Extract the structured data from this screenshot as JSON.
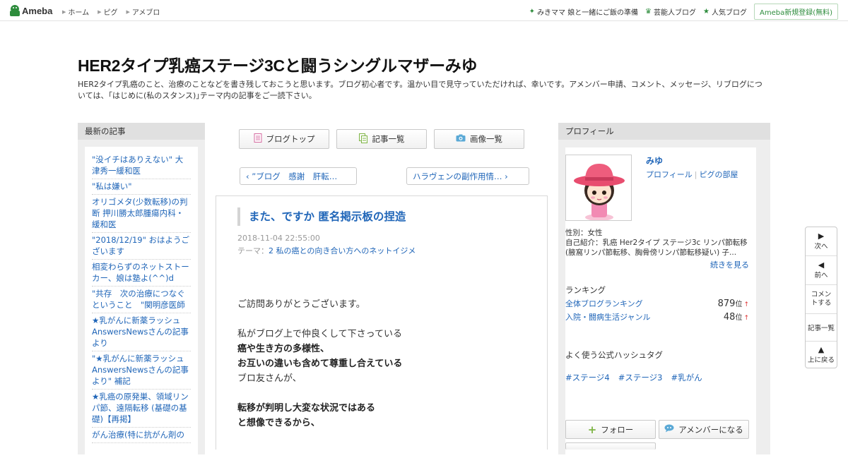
{
  "topbar": {
    "logo_text": "Ameba",
    "nav": [
      "ホーム",
      "ピグ",
      "アメブロ"
    ],
    "right_items": [
      {
        "icon": "sparkle-icon",
        "label": "みきママ 娘と一緒にご飯の準備"
      },
      {
        "icon": "crown-icon",
        "label": "芸能人ブログ"
      },
      {
        "icon": "star-icon",
        "label": "人気ブログ"
      }
    ],
    "register_label": "Ameba新規登録(無料)"
  },
  "header": {
    "title": "HER2タイプ乳癌ステージ3Cと闘うシングルマザーみゆ",
    "description": "HER2タイプ乳癌のこと、治療のことなどを書き残しておこうと思います。ブログ初心者です。温かい目で見守っていただければ、幸いです。アメンバー申請、コメント、メッセージ、リブログについては、｢はじめに(私のスタンス)｣テーマ内の記事をご一読下さい。"
  },
  "left_sidebar": {
    "heading": "最新の記事",
    "entries": [
      "\"没イチはありえない\" 大津秀一緩和医",
      "\"私は嫌い\"",
      "オリゴメタ(少数転移)の判断 押川勝太郎腫瘍内科・緩和医",
      "\"2018/12/19\" おはようございます",
      "相変わらずのネットストーカー、娘は塾よ(^^)d",
      "\"共存　次の治療につなぐということ　\"関明彦医師",
      "★乳がんに新薬ラッシュ AnswersNewsさんの記事より",
      "\"★乳がんに新薬ラッシュ AnswersNewsさんの記事より\" 補記",
      "★乳癌の原発巣、領域リンパ節、遠隔転移 (基礎の基礎)【再掲】",
      "がん治療(特に抗がん剤の"
    ]
  },
  "center": {
    "buttons": [
      {
        "icon": "blog-top-icon",
        "label": "ブログトップ"
      },
      {
        "icon": "article-list-icon",
        "label": "記事一覧"
      },
      {
        "icon": "camera-icon",
        "label": "画像一覧"
      }
    ],
    "prev_label": "‹ ”ブログ　感謝　肝転…",
    "next_label": "ハラヴェンの副作用情… ›",
    "article": {
      "title": "また、ですか 匿名掲示板の捏造",
      "date": "2018-11-04 22:55:00",
      "theme_prefix": "テーマ：",
      "theme": "2 私の癌との向き合い方へのネットイジメ",
      "body": {
        "p1": "ご訪問ありがとうございます。",
        "p2": "私がブログ上で仲良くして下さっている",
        "p3": "癌や生き方の多様性、",
        "p4": "お互いの違いも含めて尊重し合えている",
        "p5": "ブロ友さんが、",
        "p6": "転移が判明し大変な状況ではある",
        "p7": "と想像できるから、"
      }
    }
  },
  "right_sidebar": {
    "heading": "プロフィール",
    "name": "みゆ",
    "link_profile": "プロフィール",
    "link_pig": "ピグの部屋",
    "gender": "性別：女性",
    "intro": "自己紹介：乳癌 Her2タイプ ステージ3c リンパ節転移 (腋窩リンパ節転移、胸骨傍リンパ節転移疑い) 子...",
    "more": "続きを見る",
    "ranking_heading": "ランキング",
    "rankings": [
      {
        "label": "全体ブログランキング",
        "value": "879",
        "unit": "位",
        "arrow": "↑"
      },
      {
        "label": "入院・闘病生活ジャンル",
        "value": "48",
        "unit": "位",
        "arrow": "↑"
      }
    ],
    "tags_heading": "よく使う公式ハッシュタグ",
    "tags": [
      "#ステージ4",
      "#ステージ3",
      "#乳がん"
    ],
    "follow_label": "フォロー",
    "amember_label": "アメンバーになる"
  },
  "float_nav": {
    "next": "次へ",
    "prev": "前へ",
    "comment": "コメントする",
    "list": "記事一覧",
    "top": "上に戻る"
  }
}
